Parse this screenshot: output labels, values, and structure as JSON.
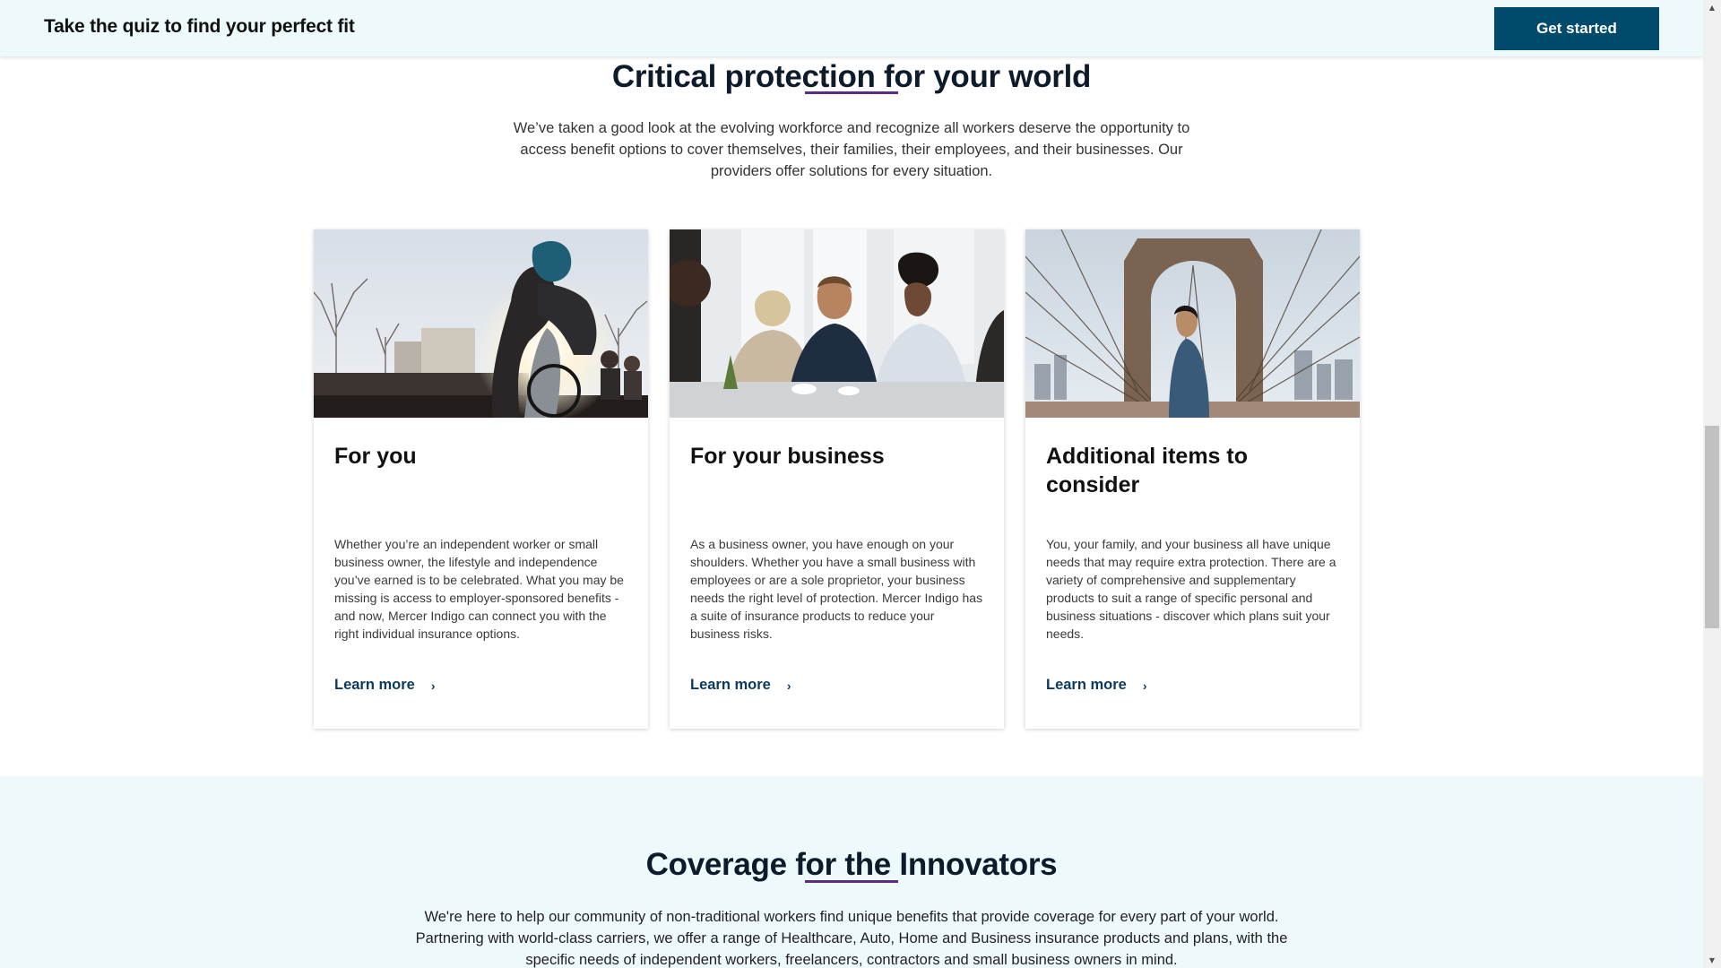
{
  "header": {
    "quiz_title": "Take the quiz to find your perfect fit",
    "cta_label": "Get started"
  },
  "section_protection": {
    "title": "Critical protection for your world",
    "intro": "We’ve taken a good look at the evolving workforce and recognize all workers deserve the opportunity to access benefit options to cover themselves, their families, their employees, and their businesses. Our providers offer solutions for every situation.",
    "cards": [
      {
        "title": "For you",
        "body": "Whether you’re an independent worker or small business owner, the lifestyle and independence you’ve earned is to be celebrated. What you may be missing is access to employer-sponsored benefits - and now, Mercer Indigo can connect you with the right individual insurance options.",
        "link": "Learn more"
      },
      {
        "title": "For your business",
        "body": "As a business owner, you have enough on your shoulders. Whether you have a small business with employees or are a sole proprietor, your business needs the right level of protection. Mercer Indigo has a suite of insurance products to reduce your business risks.",
        "link": "Learn more"
      },
      {
        "title": "Additional items to consider",
        "body": "You, your family, and your business all have unique needs that may require extra protection. There are a variety of comprehensive and supplementary products to suit a range of specific personal and business situations - discover which plans suit your needs.",
        "link": "Learn more"
      }
    ]
  },
  "section_innovators": {
    "title": "Coverage for the Innovators",
    "intro": "We're here to help our community of non-traditional workers find unique benefits that provide coverage for every part of your world. Partnering with world-class carriers, we offer a range of Healthcare, Auto, Home and Business insurance products and plans, with the specific needs of independent workers, freelancers, contractors and small business owners in mind."
  },
  "icons": {
    "chevron": "chevron-right-icon",
    "scroll_up": "scroll-up-arrow-icon",
    "scroll_down": "scroll-down-arrow-icon"
  },
  "colors": {
    "primary_button": "#004a6c",
    "accent_rule": "#5b2b86",
    "header_background": "#eef9fc",
    "link_text": "#0d3a5c"
  }
}
